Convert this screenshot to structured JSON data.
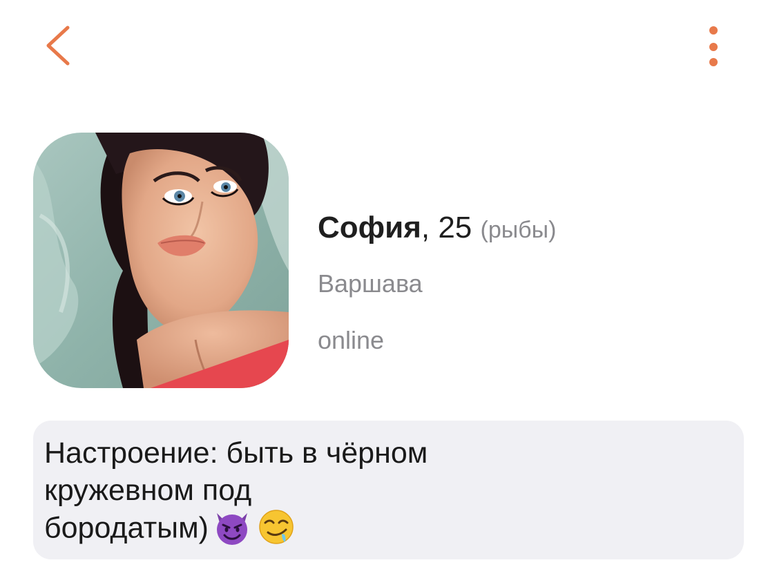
{
  "header": {
    "back_icon": "chevron-left-icon",
    "more_icon": "vertical-ellipsis-icon",
    "accent_color": "#e8794a"
  },
  "profile": {
    "name": "София",
    "age_text": ", 25",
    "zodiac": "(рыбы)",
    "city": "Варшава",
    "status": "online",
    "avatar": "profile-photo"
  },
  "mood": {
    "line1": "Настроение: быть в чёрном",
    "line2": "кружевном под",
    "line3": "бородатым)",
    "emojis": [
      "smiling-devil-emoji",
      "drooling-face-emoji"
    ],
    "background": "#f0f0f4"
  }
}
